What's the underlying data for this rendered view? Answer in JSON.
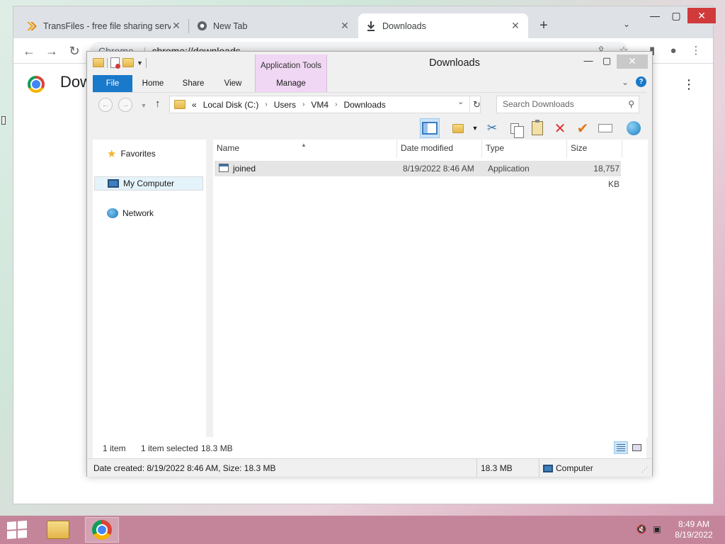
{
  "browser": {
    "tabs": [
      {
        "label": "TransFiles - free file sharing servic",
        "icon": "transfiles-icon"
      },
      {
        "label": "New Tab",
        "icon": "chrome-icon"
      },
      {
        "label": "Downloads",
        "icon": "download-icon"
      }
    ],
    "omnibox": {
      "site": "Chrome",
      "url": "chrome://downloads"
    },
    "page_title": "Dow"
  },
  "explorer": {
    "title": "Downloads",
    "contextual_tab": "Application Tools",
    "ribbon_tabs": [
      "File",
      "Home",
      "Share",
      "View",
      "Manage"
    ],
    "breadcrumb": [
      "«",
      "Local Disk (C:)",
      "Users",
      "VM4",
      "Downloads"
    ],
    "search_placeholder": "Search Downloads",
    "nav": {
      "favorites": "Favorites",
      "computer": "My Computer",
      "network": "Network"
    },
    "columns": [
      "Name",
      "Date modified",
      "Type",
      "Size"
    ],
    "files": [
      {
        "name": "joined",
        "date": "8/19/2022 8:46 AM",
        "type": "Application",
        "size": "18,757 KB"
      }
    ],
    "status": {
      "count": "1 item",
      "selected": "1 item selected",
      "selected_size": "18.3 MB"
    },
    "details_bar": {
      "created": "Date created: 8/19/2022 8:46 AM, Size: 18.3 MB",
      "size": "18.3 MB",
      "location": "Computer"
    }
  },
  "taskbar": {
    "time": "8:49 AM",
    "date": "8/19/2022"
  }
}
